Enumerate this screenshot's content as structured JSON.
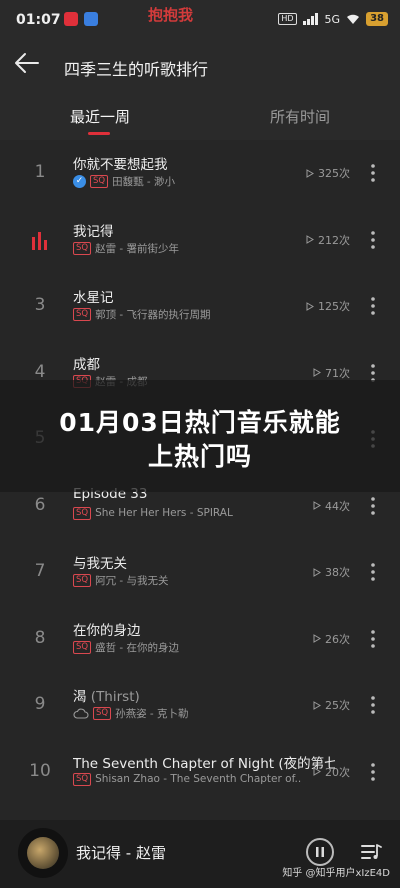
{
  "status": {
    "time": "01:07",
    "banner": "抱抱我",
    "signal": "5G",
    "hd": "HD",
    "battery": "38"
  },
  "header": {
    "title": "四季三生的听歌排行"
  },
  "tabs": [
    {
      "label": "最近一周"
    },
    {
      "label": "所有时间"
    }
  ],
  "songs": [
    {
      "rank": "1",
      "title": "你就不要想起我",
      "alias": "",
      "artist_album": "田馥甄 - 渺小",
      "plays": "325次",
      "verified": true
    },
    {
      "rank": "",
      "title": "我记得",
      "alias": "",
      "artist_album": "赵雷 - 署前街少年",
      "plays": "212次",
      "playing": true
    },
    {
      "rank": "3",
      "title": "水星记",
      "alias": "",
      "artist_album": "郭顶 - 飞行器的执行周期",
      "plays": "125次"
    },
    {
      "rank": "4",
      "title": "成都",
      "alias": "",
      "artist_album": "赵雷 - 成都",
      "plays": "71次"
    },
    {
      "rank": "5",
      "title": "",
      "alias": "",
      "artist_album": "",
      "plays": ""
    },
    {
      "rank": "6",
      "title": "Episode 33",
      "alias": "",
      "artist_album": "She Her Her Hers - SPIRAL",
      "plays": "44次"
    },
    {
      "rank": "7",
      "title": "与我无关",
      "alias": "",
      "artist_album": "阿冗 - 与我无关",
      "plays": "38次"
    },
    {
      "rank": "8",
      "title": "在你的身边",
      "alias": "",
      "artist_album": "盛哲 - 在你的身边",
      "plays": "26次"
    },
    {
      "rank": "9",
      "title": "渴",
      "alias": "(Thirst)",
      "artist_album": "孙燕姿 - 克卜勒",
      "plays": "25次",
      "cloud": true
    },
    {
      "rank": "10",
      "title": "The Seventh Chapter of Night",
      "alias": "(夜的第七章)",
      "artist_album": "Shisan Zhao - The Seventh Chapter of...",
      "plays": "20次"
    }
  ],
  "sq_label": "SQ",
  "overlay": {
    "line1": "01月03日热门音乐就能",
    "line2": "上热门吗"
  },
  "player": {
    "title": "我记得 - 赵雷"
  },
  "watermark": "知乎 @知乎用户xIzE4D",
  "colors": {
    "accent": "#e0303a",
    "background": "#262626"
  }
}
